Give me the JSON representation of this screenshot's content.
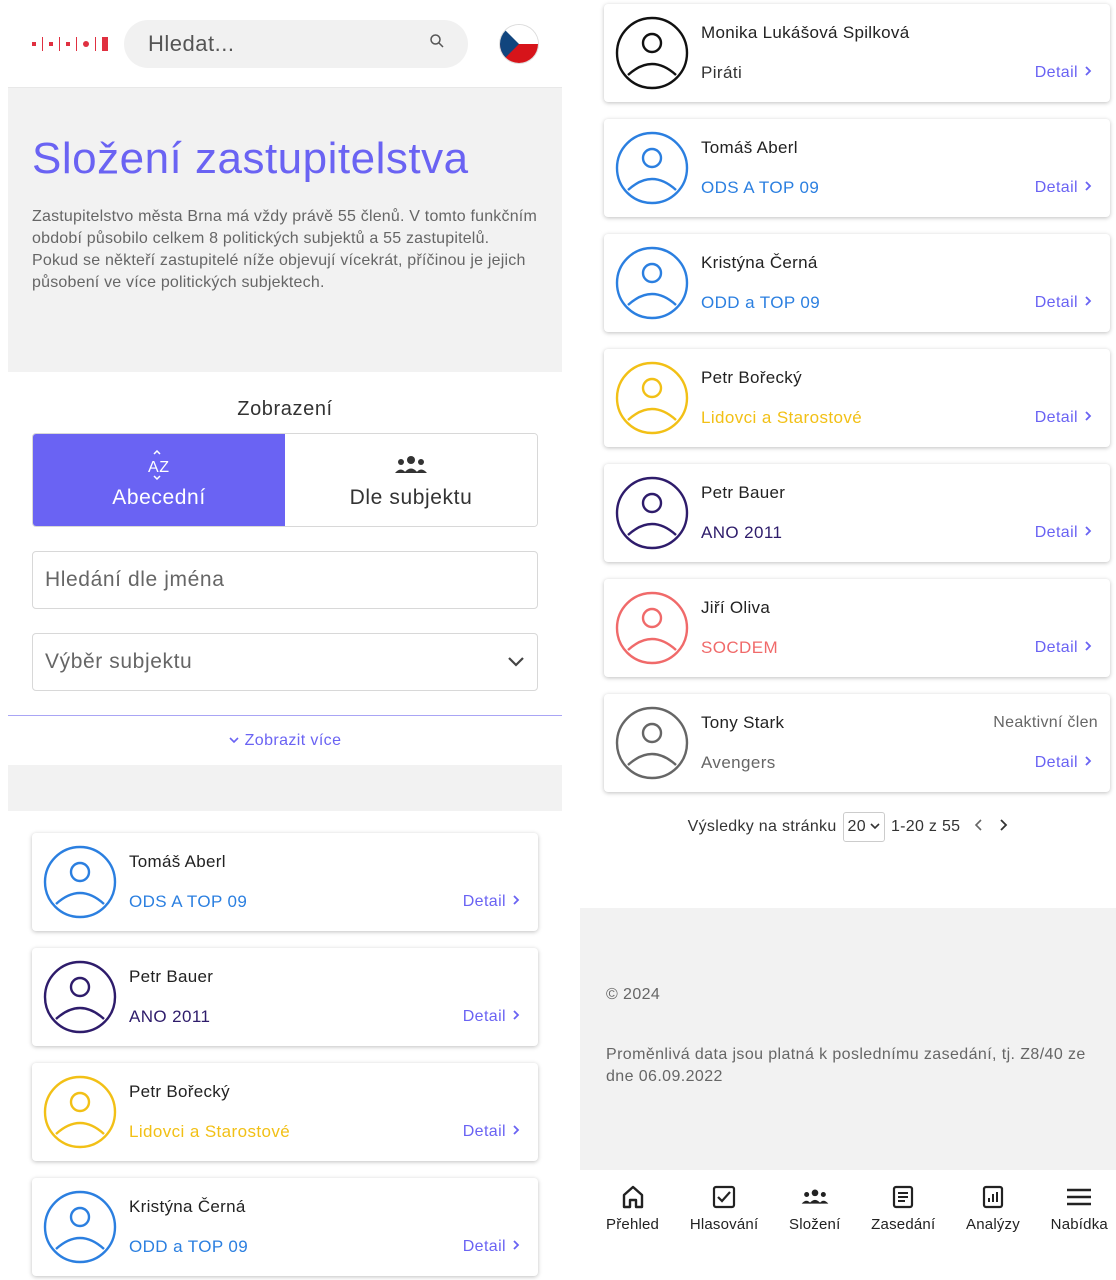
{
  "header": {
    "search_placeholder": "Hledat...",
    "language_flag": "cz-flag"
  },
  "hero": {
    "title": "Složení zastupitelstva",
    "description": "Zastupitelstvo města Brna má vždy právě 55 členů. V tomto funkčním období působilo celkem 8 politických subjektů a 55 zastupitelů. Pokud se někteří zastupitelé níže objevují vícekrát, příčinou je jejich působení ve více politických subjektech."
  },
  "view": {
    "label": "Zobrazení",
    "options": [
      {
        "label": "Abecední",
        "icon": "sort-az-icon",
        "active": true
      },
      {
        "label": "Dle subjektu",
        "icon": "people-icon",
        "active": false
      }
    ]
  },
  "filters": {
    "name_search_placeholder": "Hledání dle jména",
    "subject_select": "Výběr subjektu",
    "show_more": "Zobrazit více"
  },
  "left_members": [
    {
      "name": "Tomáš Aberl",
      "party": "ODS A TOP 09",
      "color": "#2b7fe0",
      "detail": "Detail"
    },
    {
      "name": "Petr Bauer",
      "party": "ANO 2011",
      "color": "#2e1c6b",
      "detail": "Detail"
    },
    {
      "name": "Petr Bořecký",
      "party": "Lidovci a Starostové",
      "color": "#f2c016",
      "detail": "Detail"
    },
    {
      "name": "Kristýna Černá",
      "party": "ODD a TOP 09",
      "color": "#2b7fe0",
      "detail": "Detail"
    }
  ],
  "right_members": [
    {
      "name": "Monika Lukášová Spilková",
      "party": "Piráti",
      "color": "#111111",
      "party_color": "#333333",
      "detail": "Detail",
      "status": ""
    },
    {
      "name": "Tomáš Aberl",
      "party": "ODS A TOP 09",
      "color": "#2b7fe0",
      "party_color": "#2b7fe0",
      "detail": "Detail",
      "status": ""
    },
    {
      "name": "Kristýna Černá",
      "party": "ODD a TOP 09",
      "color": "#2b7fe0",
      "party_color": "#2b7fe0",
      "detail": "Detail",
      "status": ""
    },
    {
      "name": "Petr Bořecký",
      "party": "Lidovci a Starostové",
      "color": "#f2c016",
      "party_color": "#f2c016",
      "detail": "Detail",
      "status": ""
    },
    {
      "name": "Petr Bauer",
      "party": "ANO 2011",
      "color": "#2e1c6b",
      "party_color": "#2e1c6b",
      "detail": "Detail",
      "status": ""
    },
    {
      "name": "Jiří Oliva",
      "party": "SOCDEM",
      "color": "#f06a6a",
      "party_color": "#f06a6a",
      "detail": "Detail",
      "status": ""
    },
    {
      "name": "Tony Stark",
      "party": "Avengers",
      "color": "#666666",
      "party_color": "#666666",
      "detail": "Detail",
      "status": "Neaktivní člen"
    }
  ],
  "pagination": {
    "label": "Výsledky na stránku",
    "per_page": "20",
    "range": "1-20 z 55"
  },
  "footer": {
    "copyright": "© 2024",
    "note": "Proměnlivá data jsou platná k poslednímu zasedání, tj. Z8/40 ze dne 06.09.2022"
  },
  "bottom_nav": [
    {
      "label": "Přehled",
      "icon": "home-icon"
    },
    {
      "label": "Hlasování",
      "icon": "checkbox-icon"
    },
    {
      "label": "Složení",
      "icon": "people-icon"
    },
    {
      "label": "Zasedání",
      "icon": "document-icon"
    },
    {
      "label": "Analýzy",
      "icon": "chart-icon"
    },
    {
      "label": "Nabídka",
      "icon": "menu-icon"
    }
  ],
  "colors": {
    "accent": "#6a63f3"
  }
}
